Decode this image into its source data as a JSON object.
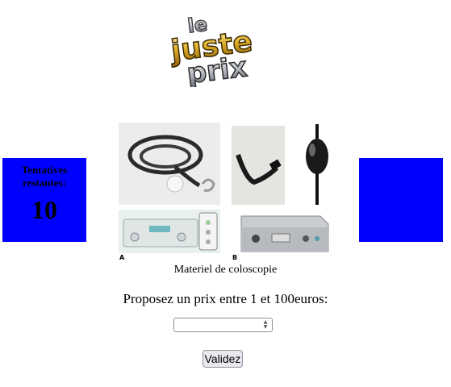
{
  "logo": {
    "lines": [
      "le",
      "juste",
      "prix"
    ]
  },
  "counter": {
    "label": "Tentatives restantes:",
    "value": "10"
  },
  "product": {
    "caption": "Materiel de coloscopie",
    "panel_labels": [
      "A",
      "B"
    ]
  },
  "form": {
    "prompt": "Proposez un prix entre 1 et 100euros:",
    "input_value": "",
    "submit_label": "Validez"
  },
  "colors": {
    "panel": "#0000ff",
    "logo_gold": "#d9a520",
    "logo_silver": "#c8ccd2"
  },
  "icons": {
    "spinner": [
      "chevron-up-icon",
      "chevron-down-icon"
    ]
  }
}
